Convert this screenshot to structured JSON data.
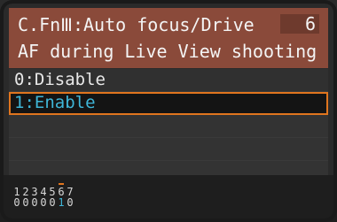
{
  "header": {
    "title_prefix": "C.Fn",
    "title_group": "Ⅲ",
    "title_rest": ":Auto focus/Drive",
    "page_number": "6",
    "subtitle": "AF during Live View shooting"
  },
  "options": [
    {
      "label": "0:Disable",
      "selected": false
    },
    {
      "label": "1:Enable",
      "selected": true
    }
  ],
  "footer": {
    "function_numbers": [
      "1",
      "2",
      "3",
      "4",
      "5",
      "6",
      "7"
    ],
    "function_values": [
      "0",
      "0",
      "0",
      "0",
      "0",
      "1",
      "0"
    ],
    "current_index": 5
  },
  "colors": {
    "header_bg": "#8a4a3a",
    "selection_border": "#e0751e",
    "selected_text": "#3fb6d8"
  }
}
